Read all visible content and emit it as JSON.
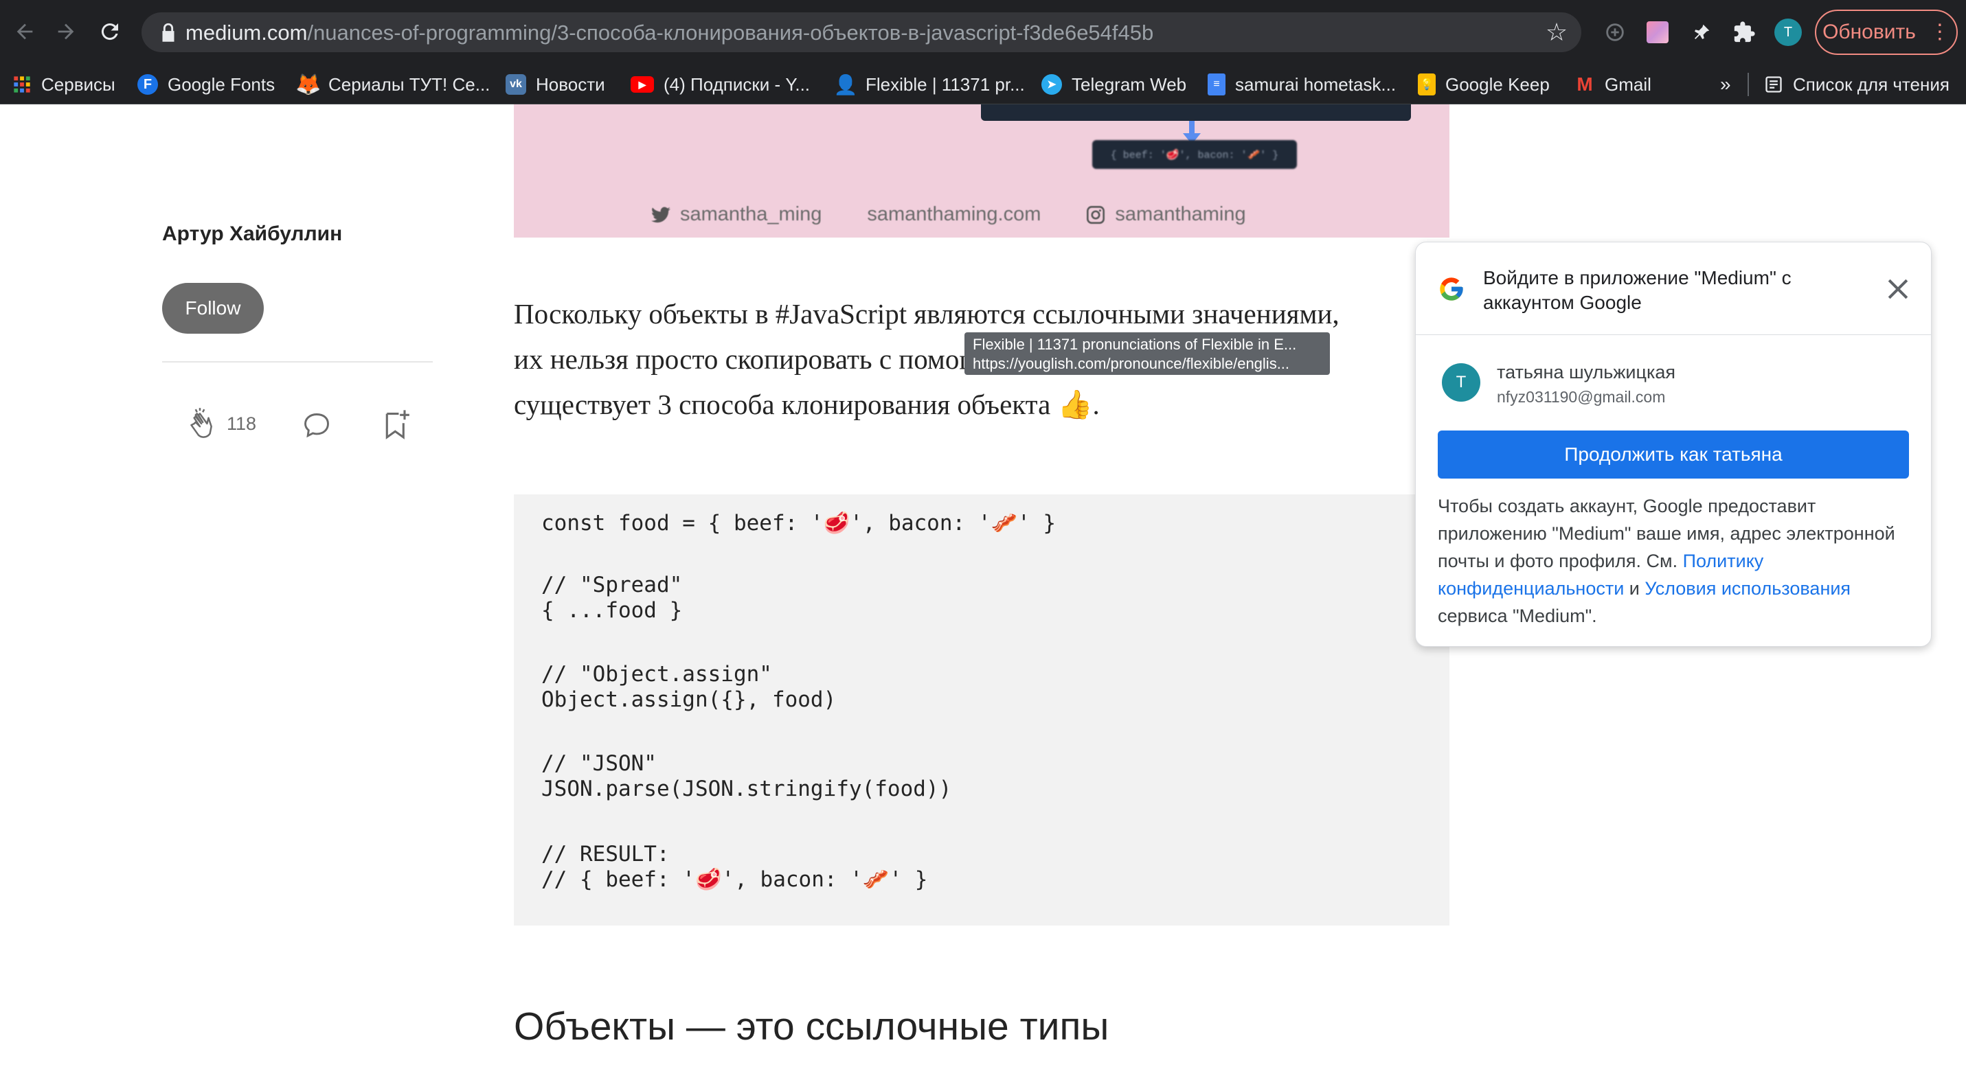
{
  "browser": {
    "url_host": "medium.com",
    "url_path": "/nuances-of-programming/3-способа-клонирования-объектов-в-javascript-f3de6e54f45b",
    "profile_initial": "T",
    "update_label": "Обновить"
  },
  "bookmarks": [
    {
      "label": "Сервисы",
      "icon": "apps-grid-icon"
    },
    {
      "label": "Google Fonts",
      "icon": "google-fonts-icon"
    },
    {
      "label": "Сериалы ТУТ! Се...",
      "icon": "serials-icon"
    },
    {
      "label": "Новости",
      "icon": "vk-icon"
    },
    {
      "label": "(4) Подписки - Y...",
      "icon": "youtube-icon"
    },
    {
      "label": "Flexible | 11371 pr...",
      "icon": "youglish-icon"
    },
    {
      "label": "Telegram Web",
      "icon": "telegram-icon"
    },
    {
      "label": "samurai hometask...",
      "icon": "google-docs-icon"
    },
    {
      "label": "Google Keep",
      "icon": "google-keep-icon"
    },
    {
      "label": "Gmail",
      "icon": "gmail-icon"
    }
  ],
  "bookmarks_overflow": "»",
  "reading_list_label": "Список для чтения",
  "hero": {
    "terminal_text": "{ beef: '🥩', bacon: '🥓' }",
    "socials": [
      "samantha_ming",
      "samanthaming.com",
      "samanthaming"
    ]
  },
  "sidebar": {
    "author": "Артур Хайбуллин",
    "follow_label": "Follow",
    "clap_count": "118"
  },
  "article": {
    "paragraph_lines": [
      "Поскольку объекты в #JavaScript являются ссылочными значениями,",
      "их нельзя просто скопировать с помощью =. Но не волнуйтесь,",
      "существует 3 способа клонирования объекта 👍."
    ],
    "code_lines": [
      "const food = { beef: '🥩', bacon: '🥓' }",
      "// \"Spread\"",
      "{ ...food }",
      "// \"Object.assign\"",
      "Object.assign({}, food)",
      "// \"JSON\"",
      "JSON.parse(JSON.stringify(food))",
      "// RESULT:",
      "// { beef: '🥩', bacon: '🥓' }"
    ],
    "heading": "Объекты — это ссылочные типы"
  },
  "tooltip": {
    "title": "Flexible | 11371 pronunciations of Flexible in E...",
    "url": "https://youglish.com/pronounce/flexible/englis..."
  },
  "google_signin": {
    "title": "Войдите в приложение \"Medium\" с аккаунтом Google",
    "user_initial": "T",
    "user_name": "татьяна шульжицкая",
    "user_email": "nfyz031190@gmail.com",
    "continue_label": "Продолжить как татьяна",
    "desc_before": "Чтобы создать аккаунт, Google предоставит приложению \"Medium\" ваше имя, адрес электронной почты и фото профиля. См. ",
    "privacy_link": "Политику конфиденциальности",
    "desc_and": " и ",
    "terms_link": "Условия использования",
    "desc_after": " сервиса \"Medium\"."
  },
  "colors": {
    "chrome_bg": "#202124",
    "omnibox_bg": "#35363a",
    "hero_pink": "#f1cfdc",
    "google_blue": "#1a73e8",
    "follow_gray": "#6b6b6b",
    "update_red": "#f28b82"
  }
}
